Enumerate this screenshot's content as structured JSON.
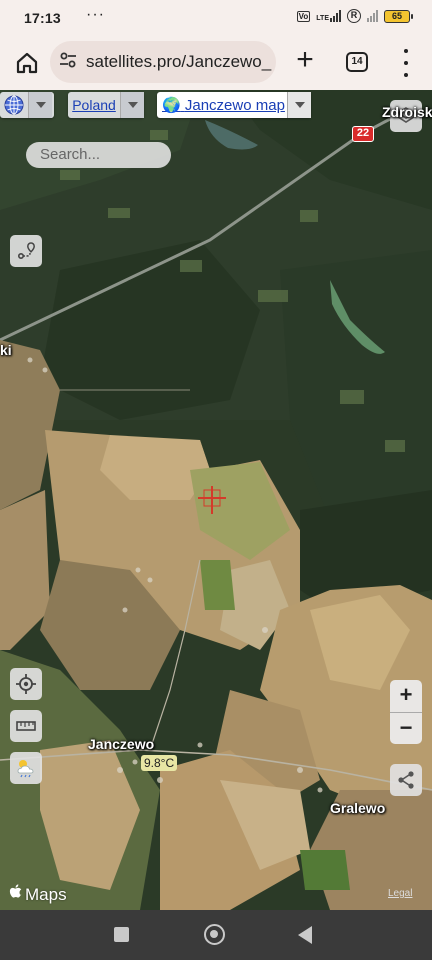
{
  "status_bar": {
    "time": "17:13",
    "overflow": "···",
    "network_label": "LTE",
    "volte": "VoLTE",
    "roaming_badge": "R",
    "battery": "65"
  },
  "browser": {
    "url": "satellites.pro/Janczewo_",
    "tab_count": "14"
  },
  "map": {
    "country_selector": "Poland",
    "map_selector": "Janczewo map",
    "map_selector_icon": "🌍",
    "search_placeholder": "Search...",
    "road_number": "22",
    "labels": {
      "zdroisko": "Zdroisk",
      "town_left": "ki",
      "janczewo": "Janczewo",
      "gralewo": "Gralewo"
    },
    "temperature": "9.8°C",
    "zoom_in": "+",
    "zoom_out": "−",
    "attribution": "Maps",
    "legal": "Legal"
  },
  "icons": {
    "home": "home-icon",
    "site_settings": "tune-icon",
    "new_tab": "plus-icon",
    "menu": "more-vertical-icon",
    "globe": "globe-icon",
    "layers": "layers-icon",
    "route": "route-icon",
    "locate": "crosshair-icon",
    "ruler": "ruler-icon",
    "weather": "weather-cloud-icon",
    "share": "share-icon",
    "apple": "apple-icon"
  },
  "colors": {
    "chrome_bg": "#f6efec",
    "url_bg": "#ece0dc",
    "link": "#1a3fb5",
    "road_shield": "#d92b2b",
    "temp_badge": "#e8e6a4",
    "forest": "#2b3a27",
    "field": "#b69b72"
  }
}
